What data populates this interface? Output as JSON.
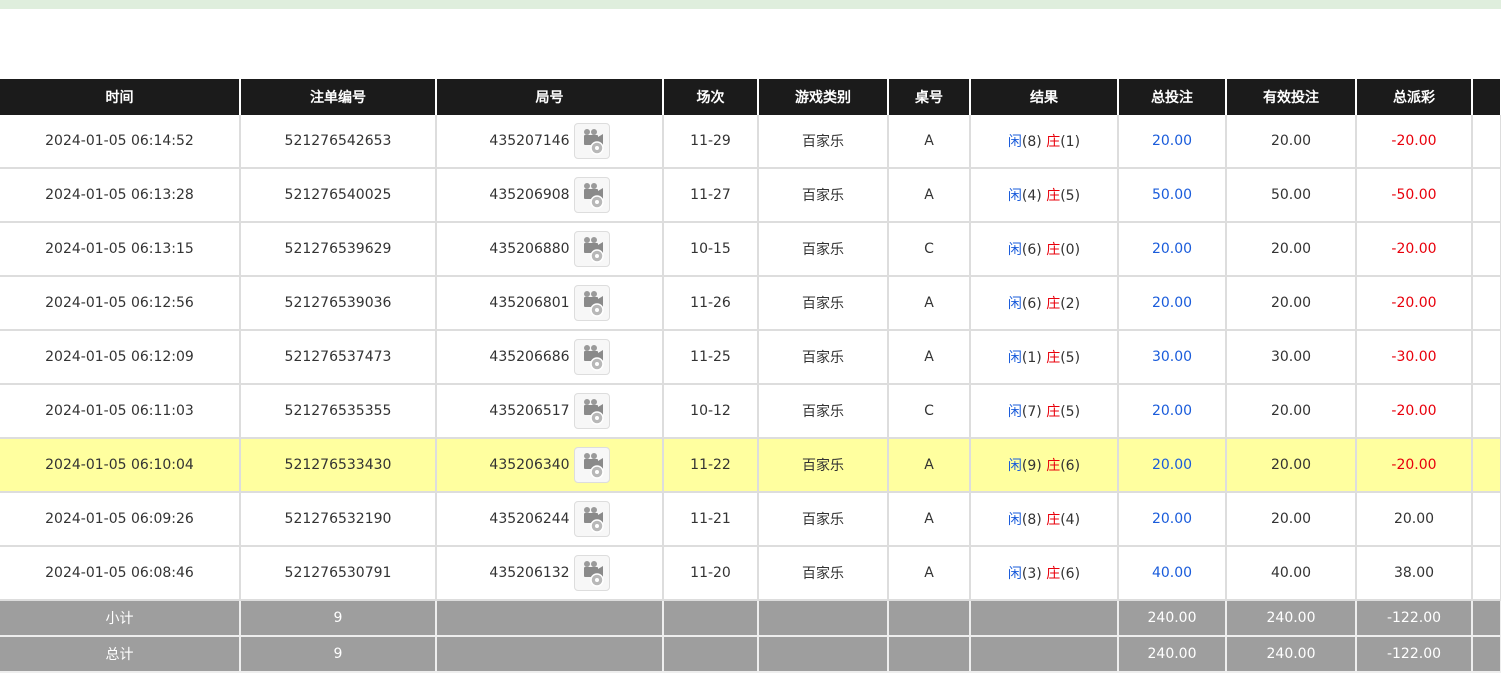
{
  "headers": [
    "时间",
    "注单编号",
    "局号",
    "场次",
    "游戏类别",
    "桌号",
    "结果",
    "总投注",
    "有效投注",
    "总派彩",
    ""
  ],
  "rows": [
    {
      "time": "2024-01-05 06:14:52",
      "bet_id": "521276542653",
      "round": "435207146",
      "session": "11-29",
      "game": "百家乐",
      "table": "A",
      "player_label": "闲",
      "player": "(8)",
      "banker_label": "庄",
      "banker": "(1)",
      "total_bet": "20.00",
      "valid_bet": "20.00",
      "payout": "-20.00",
      "payout_color": "red"
    },
    {
      "time": "2024-01-05 06:13:28",
      "bet_id": "521276540025",
      "round": "435206908",
      "session": "11-27",
      "game": "百家乐",
      "table": "A",
      "player_label": "闲",
      "player": "(4)",
      "banker_label": "庄",
      "banker": "(5)",
      "total_bet": "50.00",
      "valid_bet": "50.00",
      "payout": "-50.00",
      "payout_color": "red"
    },
    {
      "time": "2024-01-05 06:13:15",
      "bet_id": "521276539629",
      "round": "435206880",
      "session": "10-15",
      "game": "百家乐",
      "table": "C",
      "player_label": "闲",
      "player": "(6)",
      "banker_label": "庄",
      "banker": "(0)",
      "total_bet": "20.00",
      "valid_bet": "20.00",
      "payout": "-20.00",
      "payout_color": "red"
    },
    {
      "time": "2024-01-05 06:12:56",
      "bet_id": "521276539036",
      "round": "435206801",
      "session": "11-26",
      "game": "百家乐",
      "table": "A",
      "player_label": "闲",
      "player": "(6)",
      "banker_label": "庄",
      "banker": "(2)",
      "total_bet": "20.00",
      "valid_bet": "20.00",
      "payout": "-20.00",
      "payout_color": "red"
    },
    {
      "time": "2024-01-05 06:12:09",
      "bet_id": "521276537473",
      "round": "435206686",
      "session": "11-25",
      "game": "百家乐",
      "table": "A",
      "player_label": "闲",
      "player": "(1)",
      "banker_label": "庄",
      "banker": "(5)",
      "total_bet": "30.00",
      "valid_bet": "30.00",
      "payout": "-30.00",
      "payout_color": "red"
    },
    {
      "time": "2024-01-05 06:11:03",
      "bet_id": "521276535355",
      "round": "435206517",
      "session": "10-12",
      "game": "百家乐",
      "table": "C",
      "player_label": "闲",
      "player": "(7)",
      "banker_label": "庄",
      "banker": "(5)",
      "total_bet": "20.00",
      "valid_bet": "20.00",
      "payout": "-20.00",
      "payout_color": "red"
    },
    {
      "time": "2024-01-05 06:10:04",
      "bet_id": "521276533430",
      "round": "435206340",
      "session": "11-22",
      "game": "百家乐",
      "table": "A",
      "player_label": "闲",
      "player": "(9)",
      "banker_label": "庄",
      "banker": "(6)",
      "total_bet": "20.00",
      "valid_bet": "20.00",
      "payout": "-20.00",
      "payout_color": "red",
      "highlight": true
    },
    {
      "time": "2024-01-05 06:09:26",
      "bet_id": "521276532190",
      "round": "435206244",
      "session": "11-21",
      "game": "百家乐",
      "table": "A",
      "player_label": "闲",
      "player": "(8)",
      "banker_label": "庄",
      "banker": "(4)",
      "total_bet": "20.00",
      "valid_bet": "20.00",
      "payout": "20.00",
      "payout_color": "normal"
    },
    {
      "time": "2024-01-05 06:08:46",
      "bet_id": "521276530791",
      "round": "435206132",
      "session": "11-20",
      "game": "百家乐",
      "table": "A",
      "player_label": "闲",
      "player": "(3)",
      "banker_label": "庄",
      "banker": "(6)",
      "total_bet": "40.00",
      "valid_bet": "40.00",
      "payout": "38.00",
      "payout_color": "normal"
    }
  ],
  "totals": [
    {
      "label": "小计",
      "count": "9",
      "total_bet": "240.00",
      "valid_bet": "240.00",
      "payout": "-122.00"
    },
    {
      "label": "总计",
      "count": "9",
      "total_bet": "240.00",
      "valid_bet": "240.00",
      "payout": "-122.00"
    }
  ],
  "colors": {
    "header_bg": "#1b1b1b",
    "highlight_row": "#ffff9f",
    "totals_bg": "#9e9e9e",
    "blue": "#1a5cdb",
    "red": "#e8000b"
  },
  "icons": {
    "round_replay": "video-replay-icon"
  }
}
